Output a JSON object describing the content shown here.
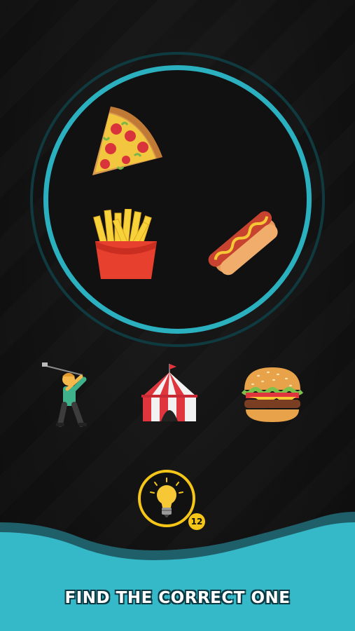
{
  "puzzle": {
    "clue_items": [
      "pizza-icon",
      "fries-icon",
      "hotdog-icon"
    ],
    "answer_options": [
      "golfer-icon",
      "circus-tent-icon",
      "hamburger-icon"
    ]
  },
  "hint": {
    "count": "12",
    "icon": "lightbulb-icon"
  },
  "instruction": "FIND THE CORRECT ONE",
  "colors": {
    "ring": "#2bb0bf",
    "ring_shadow": "#0f3a3f",
    "hint_ring": "#f5c518",
    "wave": "#35b8c8",
    "wave_edge": "#1f5f6a",
    "background": "#121212"
  }
}
